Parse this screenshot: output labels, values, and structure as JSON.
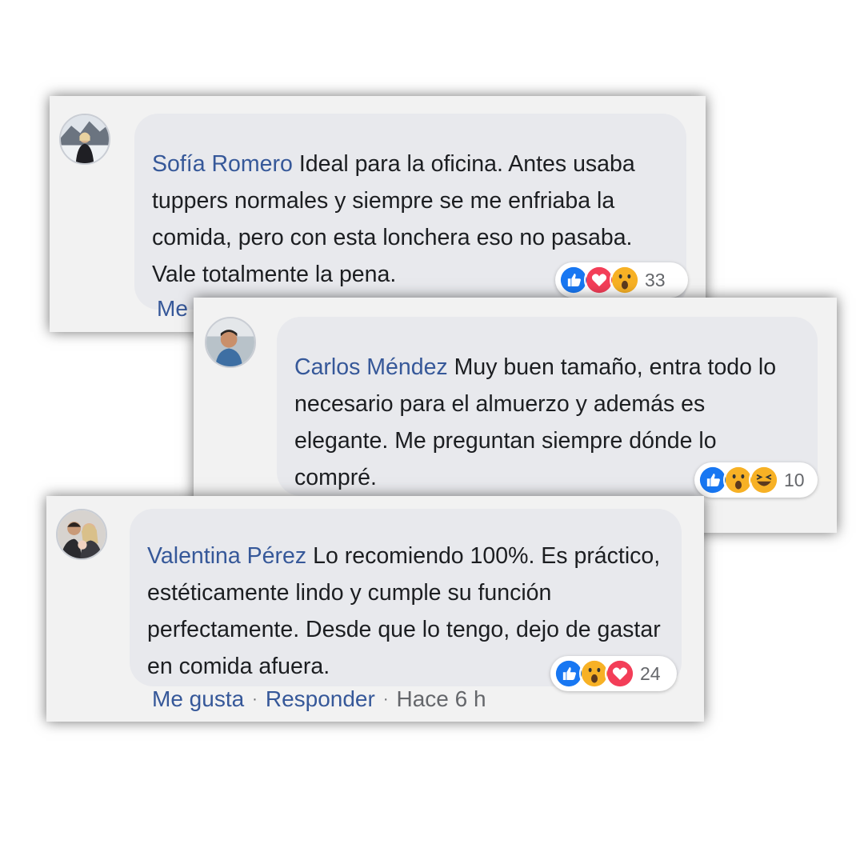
{
  "comments": [
    {
      "author": "Sofía Romero",
      "text": "Ideal para la oficina. Antes usaba tuppers normales y siempre se me enfriaba la comida, pero con esta lonchera eso no pasaba. Vale totalmente la pena.",
      "reactions": [
        "like",
        "love",
        "wow"
      ],
      "reaction_count": "33",
      "actions": {
        "like_label": "Me"
      }
    },
    {
      "author": "Carlos Méndez",
      "text": "Muy buen tamaño, entra todo lo necesario para el almuerzo y además es elegante. Me preguntan siempre dónde lo compré.",
      "reactions": [
        "like",
        "wow",
        "haha"
      ],
      "reaction_count": "10"
    },
    {
      "author": "Valentina Pérez",
      "text": "Lo recomiendo 100%. Es práctico, estéticamente lindo y cumple su función perfectamente. Desde que lo tengo, dejo de gastar en comida afuera.",
      "reactions": [
        "like",
        "wow",
        "love"
      ],
      "reaction_count": "24",
      "actions": {
        "like_label": "Me gusta",
        "reply_label": "Responder",
        "time": "Hace 6 h",
        "separator": "·"
      }
    }
  ],
  "colors": {
    "author_link": "#365899",
    "like_blue": "#1877f2",
    "love_red": "#f33e58",
    "wow_yellow": "#f7b125",
    "bubble_bg": "#e8e9ed"
  }
}
